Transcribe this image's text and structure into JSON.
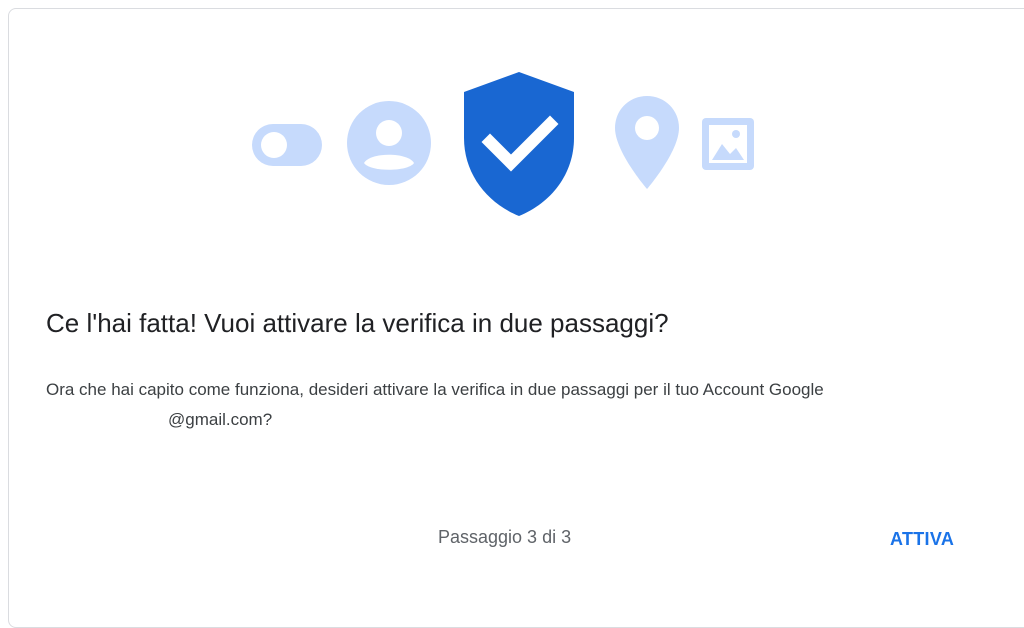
{
  "illustration": {
    "icons": [
      "toggle-icon",
      "account-icon",
      "shield-check-icon",
      "location-pin-icon",
      "image-icon"
    ],
    "colors": {
      "light_blue": "#c6dafc",
      "shield_blue": "#1967d2",
      "check_color": "#ffffff"
    }
  },
  "dialog": {
    "title": "Ce l'hai fatta! Vuoi attivare la verifica in due passaggi?",
    "description_part1": "Ora che hai capito come funziona, desideri attivare la verifica in due passaggi per il tuo Account Google",
    "email_suffix": "@gmail.com?",
    "step_indicator": "Passaggio 3 di 3",
    "activate_label": "ATTIVA"
  },
  "colors": {
    "accent": "#1a73e8",
    "title_text": "#202124",
    "body_text": "#3c4043",
    "muted_text": "#5f6368"
  }
}
